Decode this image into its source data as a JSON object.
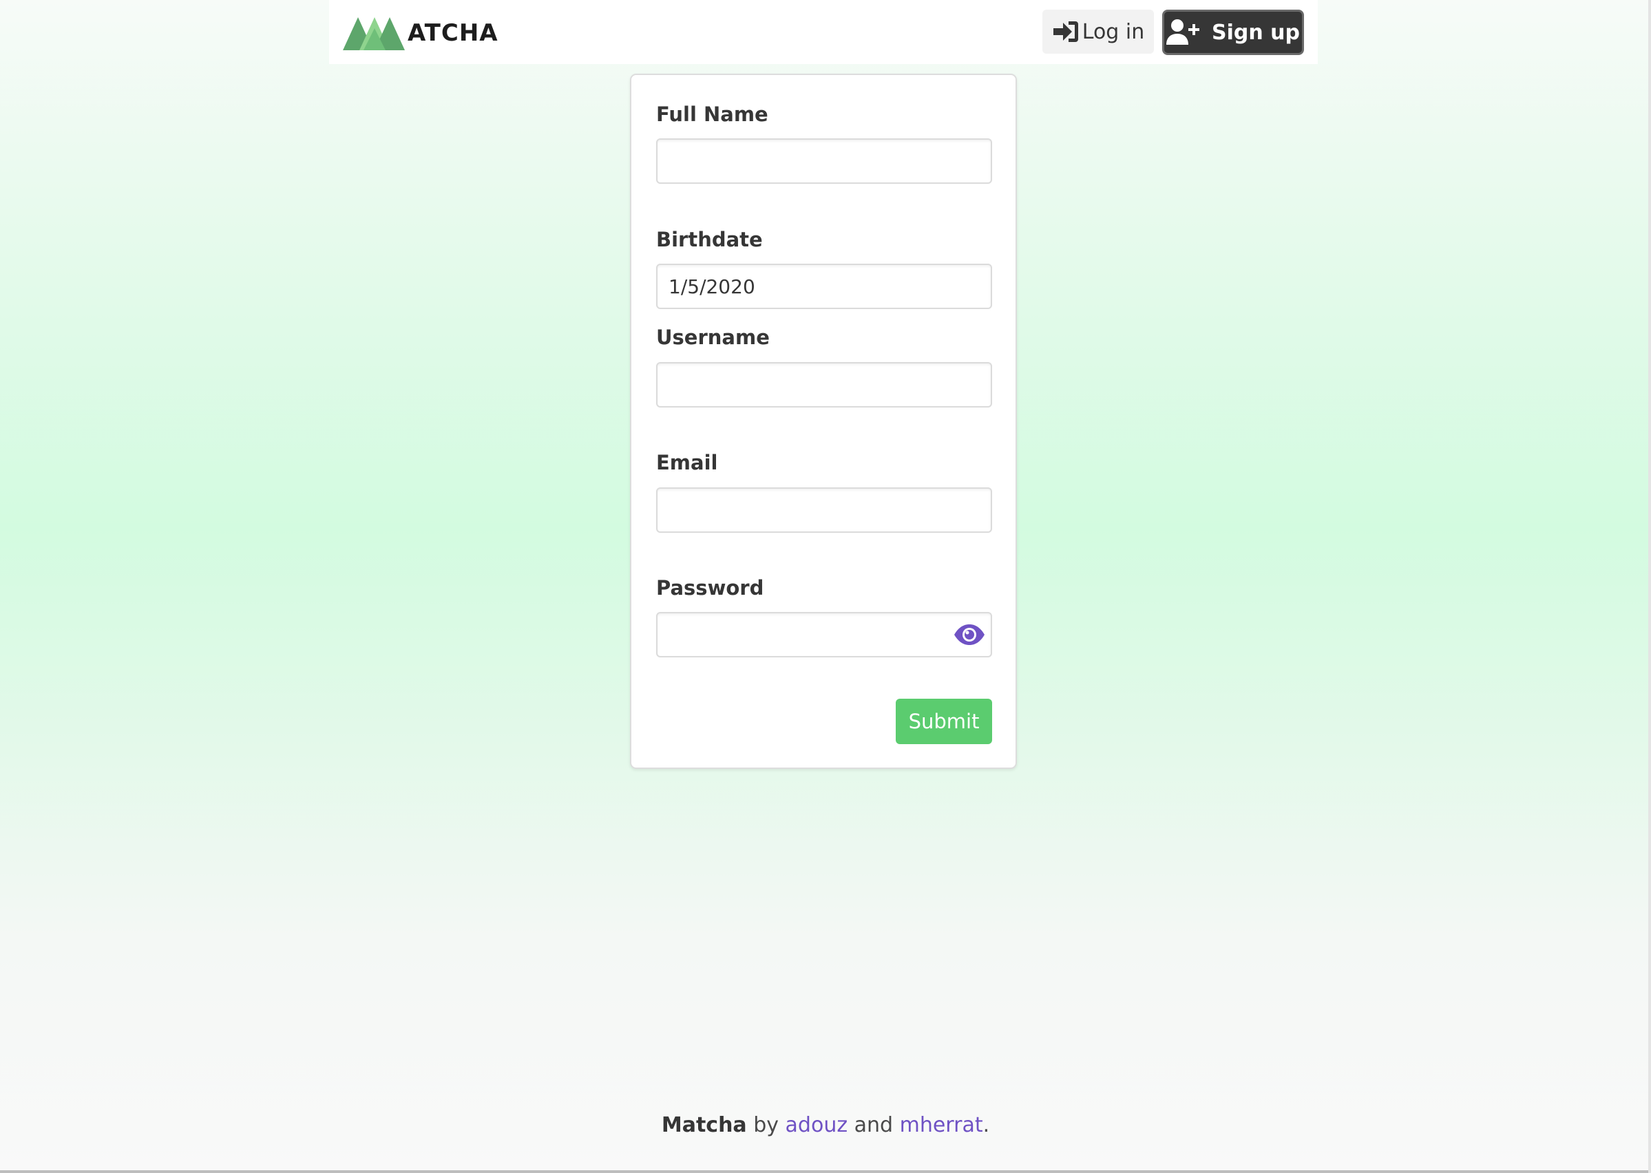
{
  "navbar": {
    "brand_text": "ATCHA",
    "login_label": "Log in",
    "signup_label": "Sign up"
  },
  "form": {
    "fields": [
      {
        "label": "Full Name",
        "value": ""
      },
      {
        "label": "Birthdate",
        "value": "1/5/2020"
      },
      {
        "label": "Username",
        "value": ""
      },
      {
        "label": "Email",
        "value": ""
      },
      {
        "label": "Password",
        "value": ""
      }
    ],
    "submit_label": "Submit"
  },
  "footer": {
    "app_name": "Matcha",
    "by": " by ",
    "author1": "adouz",
    "and": " and ",
    "author2": "mherrat",
    "end": "."
  },
  "icons": {
    "login": "sign-in-icon",
    "signup": "user-plus-icon",
    "password_toggle": "eye-icon",
    "logo": "matcha-logo-mountains"
  },
  "colors": {
    "submit": "#5bcc6f",
    "signup_bg": "#363636",
    "link": "#6f52c4",
    "eye": "#6f52c4",
    "logo_dark_green": "#5da66b",
    "logo_light_green": "#8fd48e"
  }
}
